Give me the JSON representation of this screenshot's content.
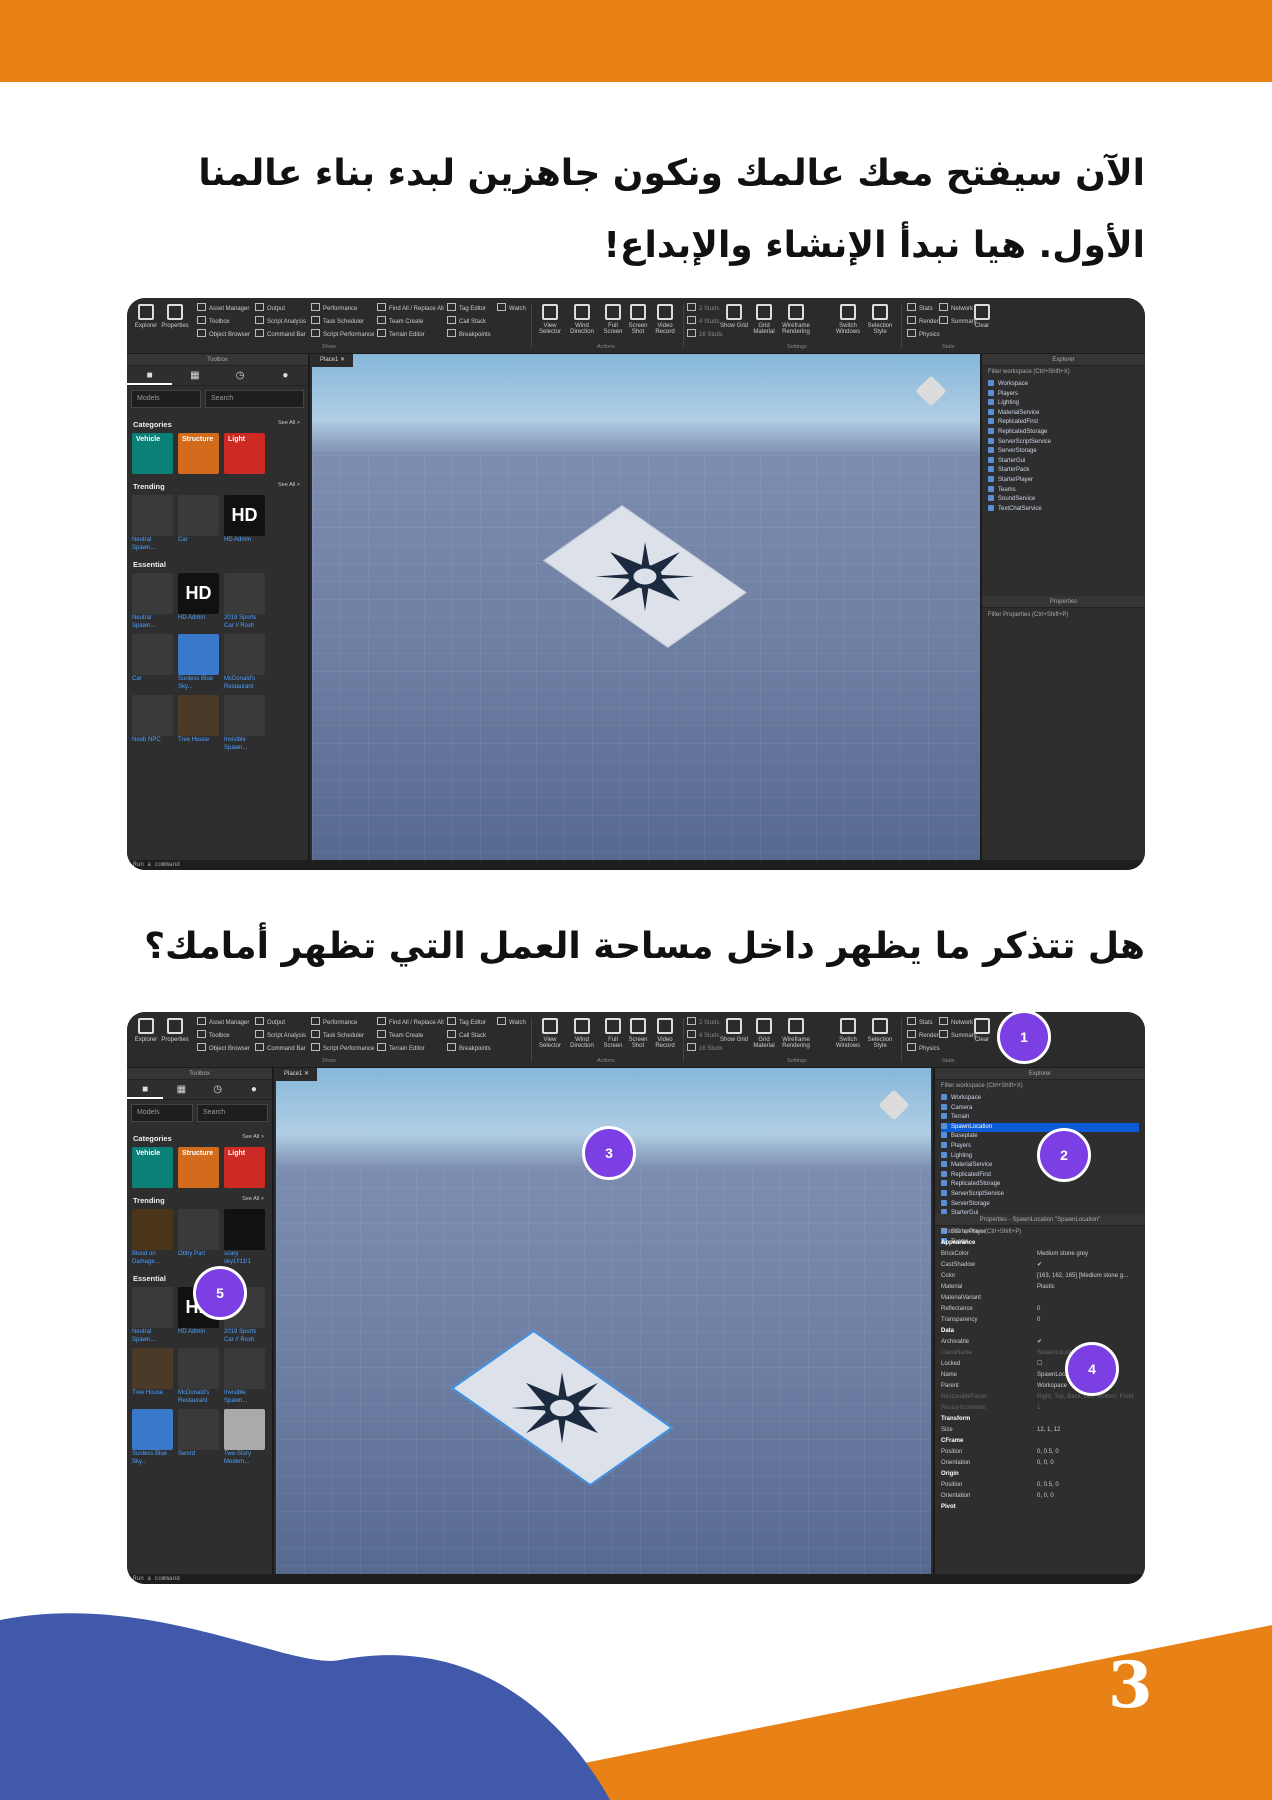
{
  "page": {
    "para1": "الآن سيفتح معك عالمك ونكون جاهزين لبدء بناء عالمنا الأول. هيا نبدأ الإنشاء والإبداع!",
    "para2": "هل تتذكر ما يظهر داخل مساحة العمل التي تظهر أمامك؟",
    "page_number": "3",
    "colors": {
      "orange": "#E88217",
      "blue": "#4059AB",
      "badge": "#7B3FE4"
    }
  },
  "studio": {
    "ribbon": {
      "explorer": "Explorer",
      "properties": "Properties",
      "col1": [
        "Asset Manager",
        "Toolbox",
        "Object Browser"
      ],
      "col2": [
        "Output",
        "Script Analysis",
        "Command Bar"
      ],
      "col3": [
        "Performance",
        "Task Scheduler",
        "Script Performance"
      ],
      "col4": [
        "Find All / Replace All",
        "Team Create",
        "Terrain Editor"
      ],
      "col5": [
        "Tag Editor",
        "Call Stack",
        "Breakpoints"
      ],
      "watch": "Watch",
      "view_selector": "View Selector",
      "wind_direction": "Wind Direction",
      "full_screen": "Full Screen",
      "screen_shot": "Screen Shot",
      "video_record": "Video Record",
      "studs": [
        "2 Studs",
        "4 Studs",
        "16 Studs"
      ],
      "show_grid": "Show Grid",
      "grid_material": "Grid Material",
      "wireframe": "Wireframe Rendering",
      "switch_windows": "Switch Windows",
      "selection_style": "Selection Style",
      "stats_col1": [
        "Stats",
        "Render",
        "Physics"
      ],
      "stats_col2": [
        "Network",
        "Summary"
      ],
      "clear": "Clear",
      "groups": {
        "show": "Show",
        "actions": "Actions",
        "settings": "Settings",
        "stats": "Stats"
      }
    },
    "toolbox": {
      "title": "Toolbox",
      "filter": "Models",
      "search_placeholder": "Search",
      "categories": "Categories",
      "see_all": "See All >",
      "category_tiles": [
        "Vehicle",
        "Structure",
        "Light"
      ],
      "trending": "Trending",
      "essential": "Essential",
      "trending_items_1": [
        "Neutral Spawn...",
        "Car",
        "HD Admin"
      ],
      "essential_items_1": [
        "Neutral Spawn...",
        "HD Admin",
        "2019 Sports Car // Rosh",
        "Car",
        "Sunless Blue Sky...",
        "McDonald's Restaurant",
        "Noob NPC",
        "Tree House",
        "Invisible Spawn..."
      ],
      "trending_items_2": [
        "Blood on Damage...",
        "Obby Part",
        "scary sky1!!11!1"
      ],
      "essential_items_2": [
        "Neutral Spawn...",
        "HD Admin",
        "2019 Sports Car // Rosh",
        "Tree House",
        "McDonald's Restaurant",
        "Invisible Spawn...",
        "Sunless Blue Sky...",
        "Sword",
        "Two-Story Modern..."
      ],
      "hd": "HD"
    },
    "viewport_tab": "Place1",
    "command_bar": "Run a command",
    "explorer": {
      "title": "Explorer",
      "filter": "Filter workspace (Ctrl+Shift+X)",
      "items_1": [
        "Workspace",
        "Players",
        "Lighting",
        "MaterialService",
        "ReplicatedFirst",
        "ReplicatedStorage",
        "ServerScriptService",
        "ServerStorage",
        "StarterGui",
        "StarterPack",
        "StarterPlayer",
        "Teams",
        "SoundService",
        "TextChatService"
      ],
      "items_2": [
        "Workspace",
        "Camera",
        "Terrain",
        "SpawnLocation",
        "Baseplate",
        "Players",
        "Lighting",
        "MaterialService",
        "ReplicatedFirst",
        "ReplicatedStorage",
        "ServerScriptService",
        "ServerStorage",
        "StarterGui",
        "StarterPack",
        "StarterPlayer",
        "Teams"
      ]
    },
    "properties": {
      "title": "Properties",
      "title_2": "Properties - SpawnLocation \"SpawnLocation\"",
      "filter": "Filter Properties (Ctrl+Shift+P)",
      "rows": [
        [
          "Appearance",
          ""
        ],
        [
          "BrickColor",
          "Medium stone grey"
        ],
        [
          "CastShadow",
          "✔"
        ],
        [
          "Color",
          "[163, 162, 165] [Medium stone g..."
        ],
        [
          "Material",
          "Plastic"
        ],
        [
          "MaterialVariant",
          ""
        ],
        [
          "Reflectance",
          "0"
        ],
        [
          "Transparency",
          "0"
        ],
        [
          "Data",
          ""
        ],
        [
          "Archivable",
          "✔"
        ],
        [
          "ClassName",
          "SpawnLocation"
        ],
        [
          "Locked",
          "☐"
        ],
        [
          "Name",
          "SpawnLocation"
        ],
        [
          "Parent",
          "Workspace"
        ],
        [
          "ResizeableFaces",
          "Right, Top, Back, Left, Bottom, Front"
        ],
        [
          "ResizeIncrement",
          "1"
        ],
        [
          "Transform",
          ""
        ],
        [
          "Size",
          "12, 1, 12"
        ],
        [
          "CFrame",
          ""
        ],
        [
          "Position",
          "0, 0.5, 0"
        ],
        [
          "Orientation",
          "0, 0, 0"
        ],
        [
          "Origin",
          ""
        ],
        [
          "Position",
          "0, 0.5, 0"
        ],
        [
          "Orientation",
          "0, 0, 0"
        ],
        [
          "Pivot",
          ""
        ]
      ]
    },
    "badges": [
      "1",
      "2",
      "3",
      "4",
      "5"
    ]
  }
}
